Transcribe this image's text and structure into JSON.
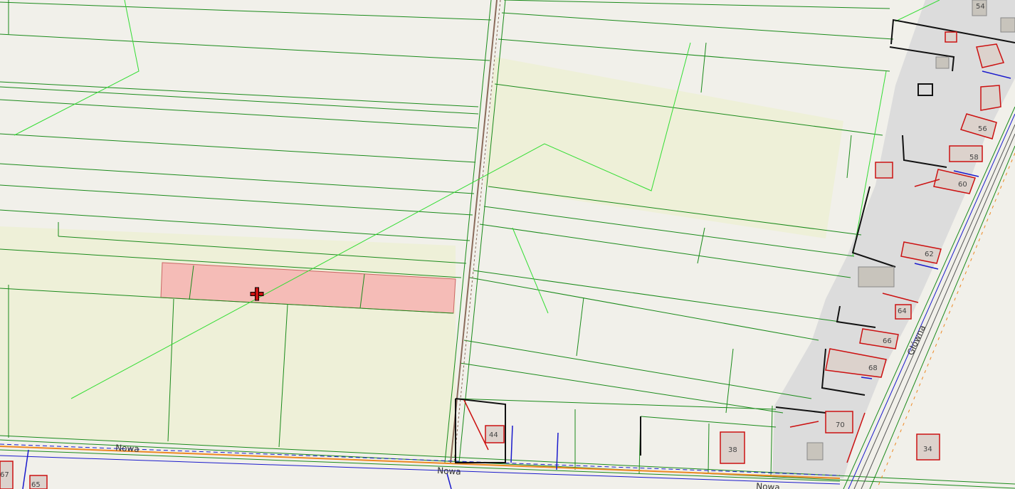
{
  "map": {
    "colors": {
      "background": "#f1f0ea",
      "farmland": "#eef0d8",
      "built_area": "#dcdcdc",
      "parcel_line": "#1a8a1a",
      "boundary_line": "#33dd33",
      "selected_parcel": "#f5bcb7",
      "building_outline": "#cc1111",
      "utility_blue": "#1a1acc",
      "utility_orange": "#ee8822",
      "fence_dark": "#111111",
      "railway": "#8a6a5a"
    },
    "road_labels": {
      "nowa_1": "Nowa",
      "nowa_2": "Nowa",
      "nowa_3": "Nowa",
      "glowna": "Główna"
    },
    "house_numbers": {
      "n34": "34",
      "n38": "38",
      "n44": "44",
      "n54": "54",
      "n56": "56",
      "n58": "58",
      "n60": "60",
      "n62": "62",
      "n64": "64",
      "n65": "65",
      "n66": "66",
      "n67": "67",
      "n68": "68",
      "n70": "70"
    },
    "marker": {
      "icon": "crosshair-icon"
    }
  }
}
